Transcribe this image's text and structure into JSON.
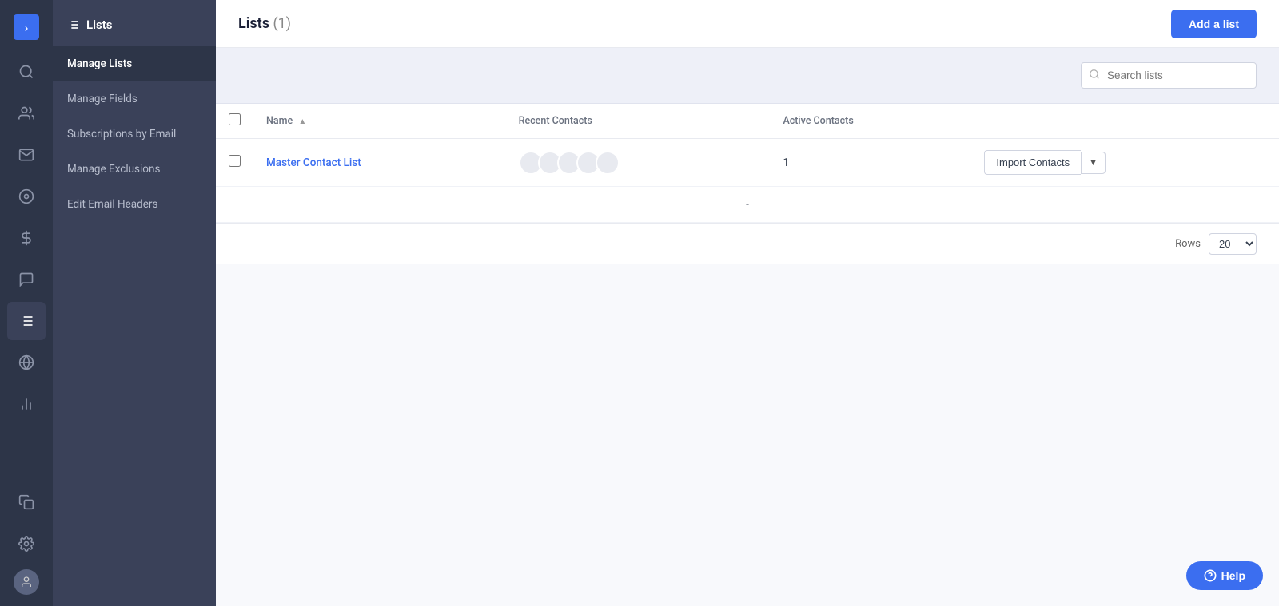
{
  "app": {
    "title": "Lists",
    "lists_count": "(1)"
  },
  "header": {
    "title": "Lists",
    "count": "(1)",
    "add_button_label": "Add a list"
  },
  "sidebar": {
    "title": "Lists",
    "items": [
      {
        "id": "manage-lists",
        "label": "Manage Lists",
        "active": true
      },
      {
        "id": "manage-fields",
        "label": "Manage Fields",
        "active": false
      },
      {
        "id": "subscriptions-by-email",
        "label": "Subscriptions by Email",
        "active": false
      },
      {
        "id": "manage-exclusions",
        "label": "Manage Exclusions",
        "active": false
      },
      {
        "id": "edit-email-headers",
        "label": "Edit Email Headers",
        "active": false
      }
    ]
  },
  "icon_nav": {
    "items": [
      {
        "id": "search",
        "icon": "🔍",
        "active": false
      },
      {
        "id": "contacts",
        "icon": "👥",
        "active": false
      },
      {
        "id": "email",
        "icon": "✉",
        "active": false
      },
      {
        "id": "analytics",
        "icon": "◎",
        "active": false
      },
      {
        "id": "revenue",
        "icon": "$",
        "active": false
      },
      {
        "id": "messages",
        "icon": "💬",
        "active": false
      },
      {
        "id": "lists",
        "icon": "≡",
        "active": true
      },
      {
        "id": "globe",
        "icon": "🌐",
        "active": false
      },
      {
        "id": "reports",
        "icon": "📊",
        "active": false
      }
    ],
    "bottom": [
      {
        "id": "copy",
        "icon": "⧉"
      },
      {
        "id": "settings",
        "icon": "⚙"
      }
    ]
  },
  "toolbar": {
    "search_placeholder": "Search lists"
  },
  "table": {
    "columns": [
      {
        "id": "name",
        "label": "Name",
        "sortable": true
      },
      {
        "id": "recent_contacts",
        "label": "Recent Contacts"
      },
      {
        "id": "active_contacts",
        "label": "Active Contacts"
      }
    ],
    "rows": [
      {
        "id": "master-contact-list",
        "name": "Master Contact List",
        "recent_contacts_count": 5,
        "active_contacts": "1",
        "import_button": "Import Contacts"
      }
    ]
  },
  "pagination": {
    "rows_label": "Rows",
    "rows_value": "20"
  },
  "help_button": {
    "label": "Help"
  }
}
